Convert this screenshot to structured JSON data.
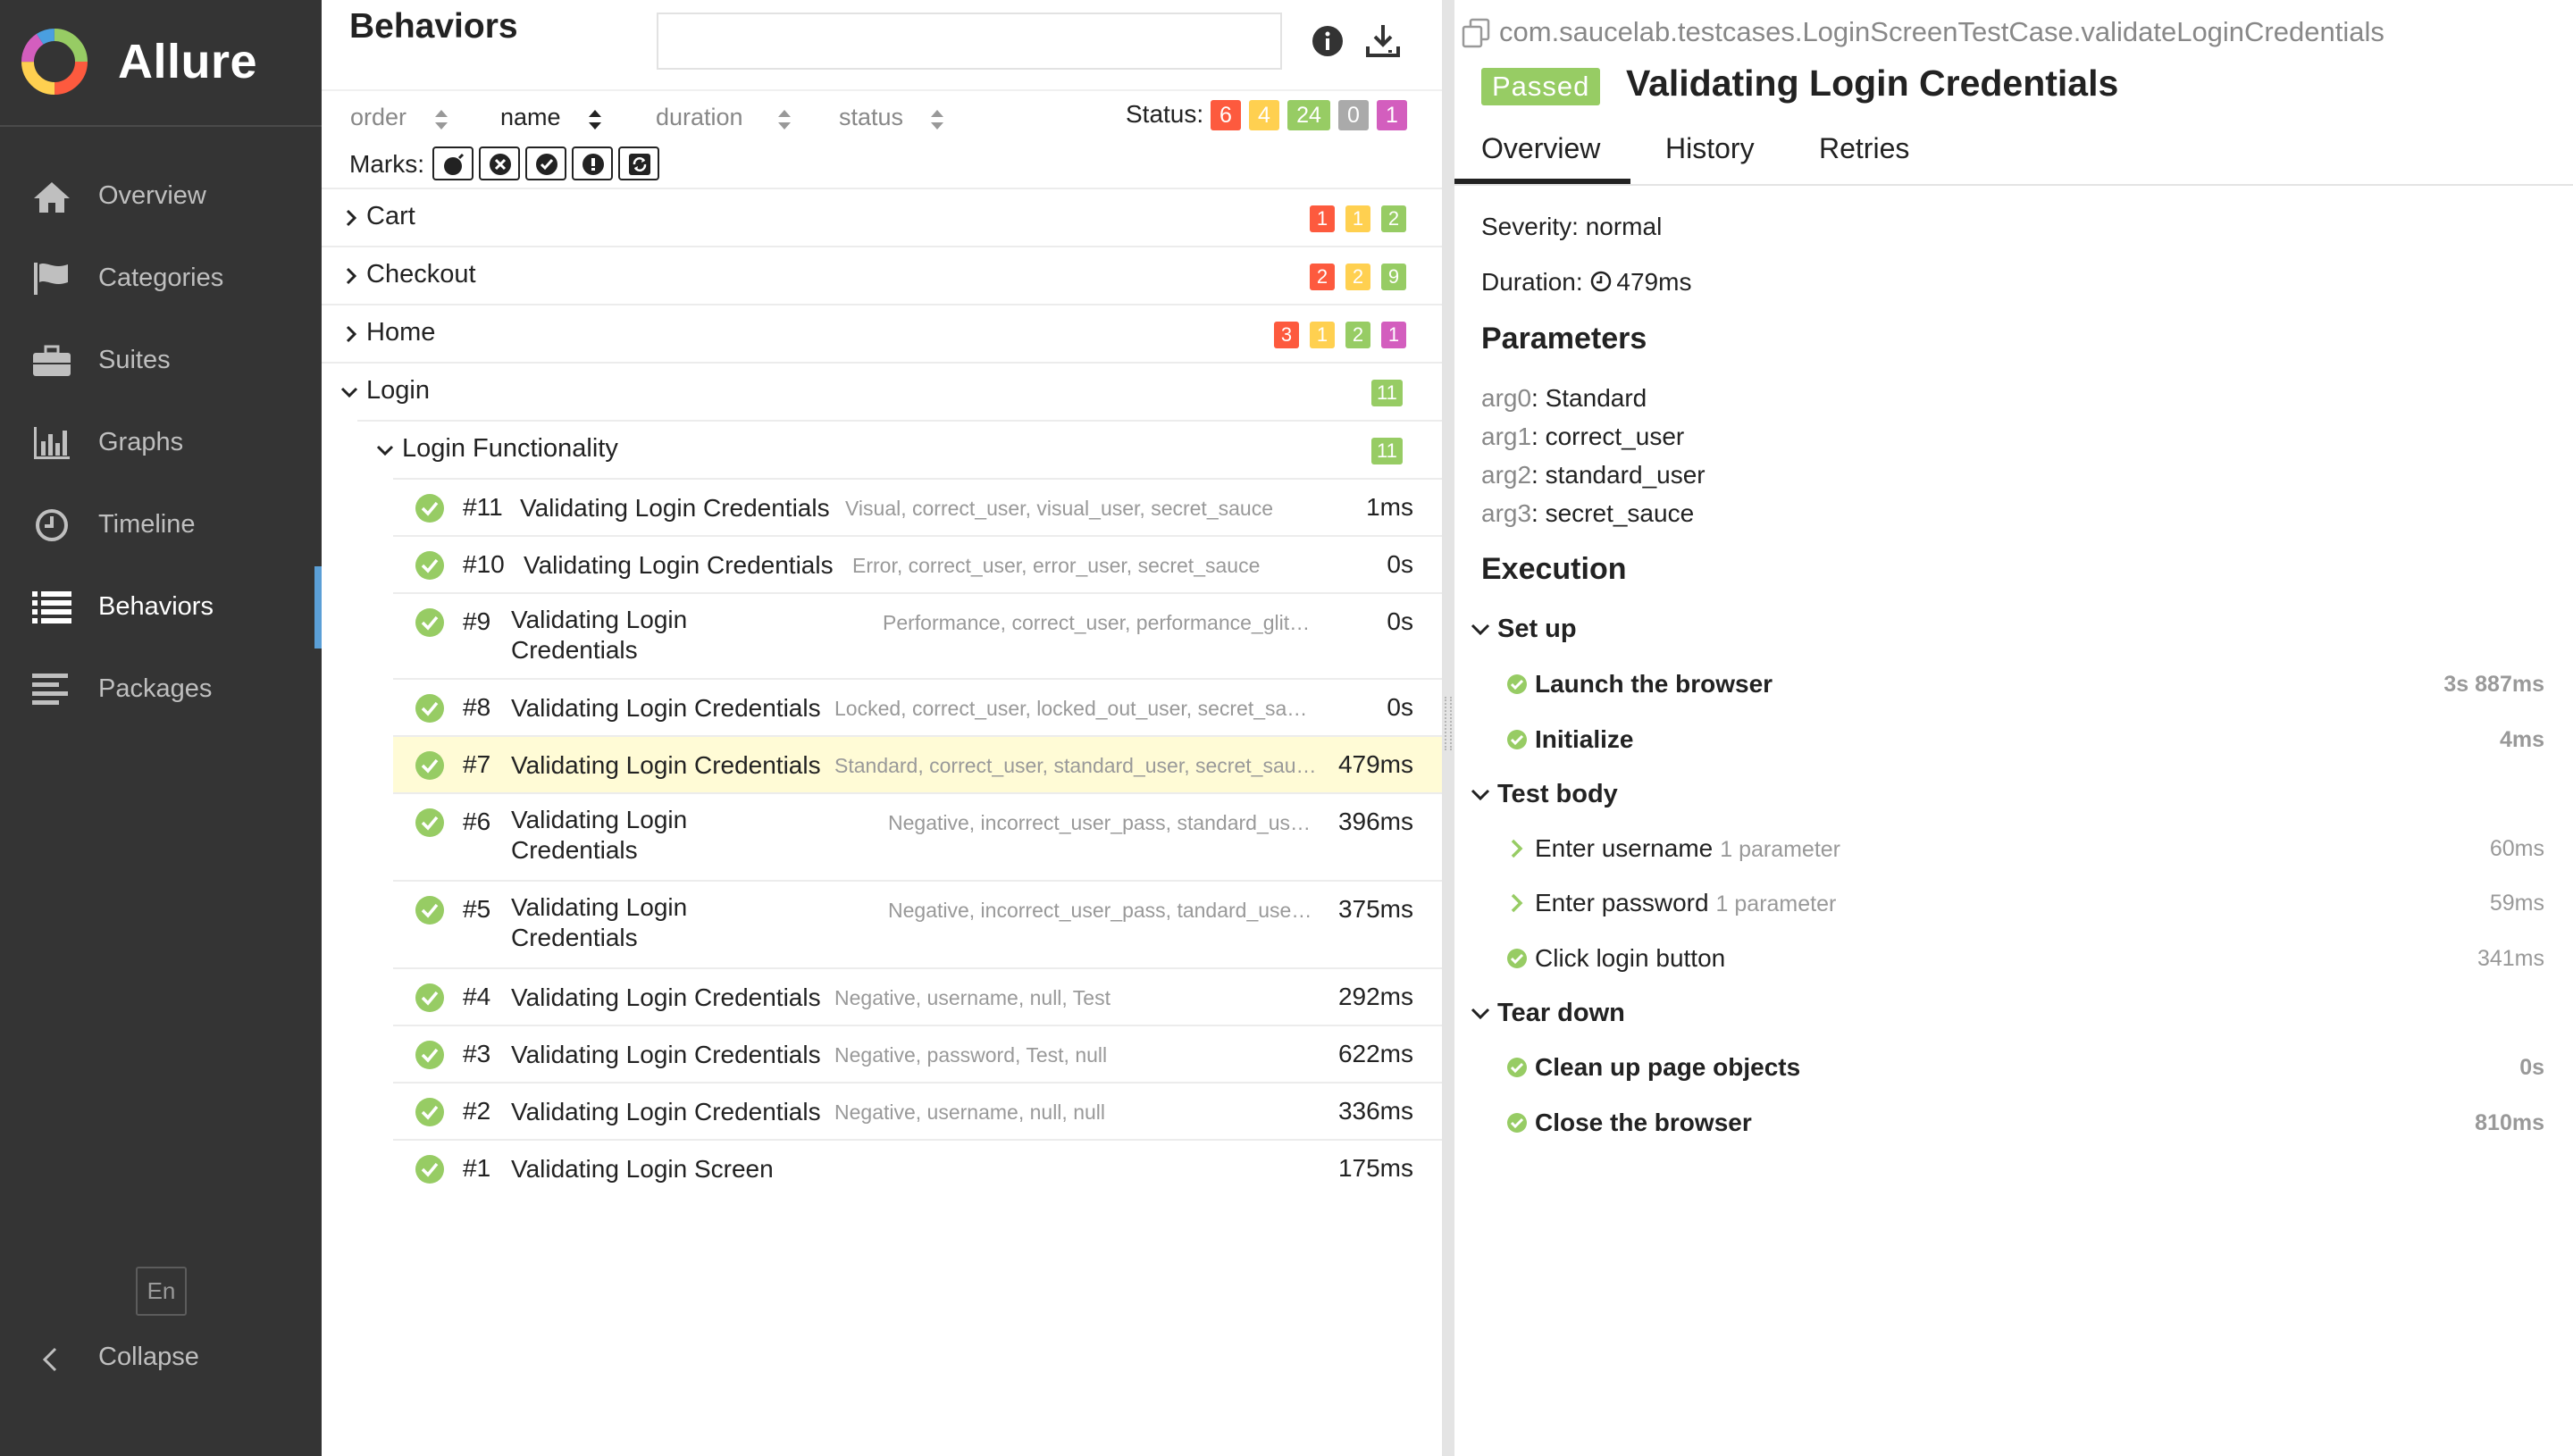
{
  "app": {
    "name": "Allure"
  },
  "sidebar": {
    "items": [
      {
        "label": "Overview",
        "icon": "home-icon"
      },
      {
        "label": "Categories",
        "icon": "flag-icon"
      },
      {
        "label": "Suites",
        "icon": "briefcase-icon"
      },
      {
        "label": "Graphs",
        "icon": "bar-chart-icon"
      },
      {
        "label": "Timeline",
        "icon": "clock-icon"
      },
      {
        "label": "Behaviors",
        "icon": "list-icon",
        "active": true
      },
      {
        "label": "Packages",
        "icon": "align-left-icon"
      }
    ],
    "language": "En",
    "collapse_label": "Collapse"
  },
  "behaviors": {
    "title": "Behaviors",
    "search": {
      "value": "",
      "placeholder": ""
    },
    "sort": {
      "order_label": "order",
      "name_label": "name",
      "duration_label": "duration",
      "status_label": "status",
      "active": "name"
    },
    "status_filter": {
      "label": "Status:",
      "counts": [
        {
          "value": "6",
          "color": "#fd5a3e"
        },
        {
          "value": "4",
          "color": "#ffd050"
        },
        {
          "value": "24",
          "color": "#97cc64"
        },
        {
          "value": "0",
          "color": "#aaaaaa"
        },
        {
          "value": "1",
          "color": "#d35ebe"
        }
      ]
    },
    "marks_label": "Marks:",
    "marks": [
      "flaky-icon",
      "new-failed-icon",
      "new-passed-icon",
      "new-broken-icon",
      "retries-icon"
    ],
    "groups": [
      {
        "name": "Cart",
        "expanded": false,
        "counts": [
          {
            "value": "1",
            "color": "#fd5a3e"
          },
          {
            "value": "1",
            "color": "#ffd050"
          },
          {
            "value": "2",
            "color": "#97cc64"
          }
        ]
      },
      {
        "name": "Checkout",
        "expanded": false,
        "counts": [
          {
            "value": "2",
            "color": "#fd5a3e"
          },
          {
            "value": "2",
            "color": "#ffd050"
          },
          {
            "value": "9",
            "color": "#97cc64"
          }
        ]
      },
      {
        "name": "Home",
        "expanded": false,
        "counts": [
          {
            "value": "3",
            "color": "#fd5a3e"
          },
          {
            "value": "1",
            "color": "#ffd050"
          },
          {
            "value": "2",
            "color": "#97cc64"
          },
          {
            "value": "1",
            "color": "#d35ebe"
          }
        ]
      },
      {
        "name": "Login",
        "expanded": true,
        "counts": [
          {
            "value": "11",
            "color": "#97cc64"
          }
        ]
      }
    ],
    "subgroup": {
      "name": "Login Functionality",
      "counts": [
        {
          "value": "11",
          "color": "#97cc64"
        }
      ]
    },
    "testcases": [
      {
        "num": "#11",
        "name": "Validating Login Credentials",
        "params": "Visual, correct_user, visual_user, secret_sauce",
        "duration": "1ms"
      },
      {
        "num": "#10",
        "name": "Validating Login Credentials",
        "params": "Error, correct_user, error_user, secret_sauce",
        "duration": "0s"
      },
      {
        "num": "#9",
        "name": "Validating Login Credentials",
        "params": "Performance, correct_user, performance_glitch_user, secret_sauce",
        "duration": "0s"
      },
      {
        "num": "#8",
        "name": "Validating Login Credentials",
        "params": "Locked, correct_user, locked_out_user, secret_sauce",
        "duration": "0s"
      },
      {
        "num": "#7",
        "name": "Validating Login Credentials",
        "params": "Standard, correct_user, standard_user, secret_sauce",
        "duration": "479ms",
        "selected": true
      },
      {
        "num": "#6",
        "name": "Validating Login Credentials",
        "params": "Negative, incorrect_user_pass, standard_user, ecret_sauce",
        "duration": "396ms"
      },
      {
        "num": "#5",
        "name": "Validating Login Credentials",
        "params": "Negative, incorrect_user_pass, tandard_user, secret_sauce",
        "duration": "375ms"
      },
      {
        "num": "#4",
        "name": "Validating Login Credentials",
        "params": "Negative, username, null, Test",
        "duration": "292ms"
      },
      {
        "num": "#3",
        "name": "Validating Login Credentials",
        "params": "Negative, password, Test, null",
        "duration": "622ms"
      },
      {
        "num": "#2",
        "name": "Validating Login Credentials",
        "params": "Negative, username, null, null",
        "duration": "336ms"
      },
      {
        "num": "#1",
        "name": "Validating Login Screen",
        "params": "",
        "duration": "175ms"
      }
    ]
  },
  "detail": {
    "path": "com.saucelab.testcases.LoginScreenTestCase.validateLoginCredentials",
    "status": "Passed",
    "title": "Validating Login Credentials",
    "tabs": [
      "Overview",
      "History",
      "Retries"
    ],
    "active_tab": "Overview",
    "severity": "Severity: normal",
    "duration_label": "Duration:",
    "duration_value": "479ms",
    "parameters_heading": "Parameters",
    "parameters": [
      {
        "key": "arg0",
        "value": ": Standard"
      },
      {
        "key": "arg1",
        "value": ": correct_user"
      },
      {
        "key": "arg2",
        "value": ": standard_user"
      },
      {
        "key": "arg3",
        "value": ": secret_sauce"
      }
    ],
    "execution_heading": "Execution",
    "stages": [
      {
        "name": "Set up",
        "steps": [
          {
            "name": "Launch the browser",
            "duration": "3s 887ms",
            "bold": true,
            "icon": "check-circle-icon"
          },
          {
            "name": "Initialize",
            "duration": "4ms",
            "bold": true,
            "icon": "check-circle-icon"
          }
        ]
      },
      {
        "name": "Test body",
        "steps": [
          {
            "name": "Enter username",
            "count": "1 parameter",
            "duration": "60ms",
            "bold": false,
            "icon": "chevron-right-icon"
          },
          {
            "name": "Enter password",
            "count": "1 parameter",
            "duration": "59ms",
            "bold": false,
            "icon": "chevron-right-icon"
          },
          {
            "name": "Click login button",
            "duration": "341ms",
            "bold": false,
            "icon": "check-circle-icon"
          }
        ]
      },
      {
        "name": "Tear down",
        "steps": [
          {
            "name": "Clean up page objects",
            "duration": "0s",
            "bold": true,
            "icon": "check-circle-icon"
          },
          {
            "name": "Close the browser",
            "duration": "810ms",
            "bold": true,
            "icon": "check-circle-icon"
          }
        ]
      }
    ]
  }
}
